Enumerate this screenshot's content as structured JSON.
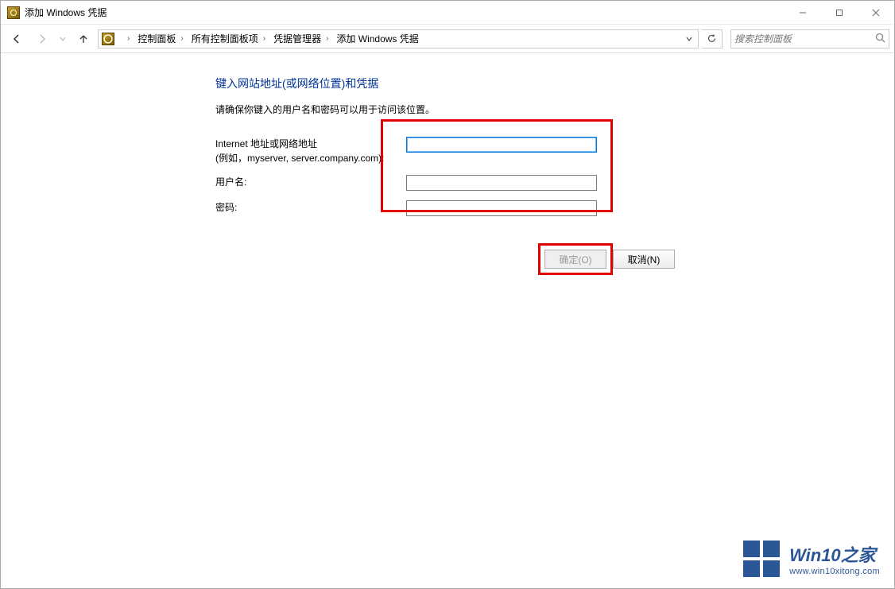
{
  "titlebar": {
    "title": "添加 Windows 凭据"
  },
  "breadcrumbs": {
    "items": [
      "控制面板",
      "所有控制面板项",
      "凭据管理器",
      "添加 Windows 凭据"
    ]
  },
  "search": {
    "placeholder": "搜索控制面板"
  },
  "page": {
    "heading": "键入网站地址(或网络位置)和凭据",
    "subtext": "请确保你键入的用户名和密码可以用于访问该位置。"
  },
  "form": {
    "address_label": "Internet 地址或网络地址",
    "address_hint": "(例如，myserver, server.company.com):",
    "username_label": "用户名:",
    "password_label": "密码:",
    "address_value": "",
    "username_value": "",
    "password_value": ""
  },
  "buttons": {
    "ok": "确定(O)",
    "cancel": "取消(N)"
  },
  "watermark": {
    "title": "Win10之家",
    "url": "www.win10xitong.com"
  }
}
